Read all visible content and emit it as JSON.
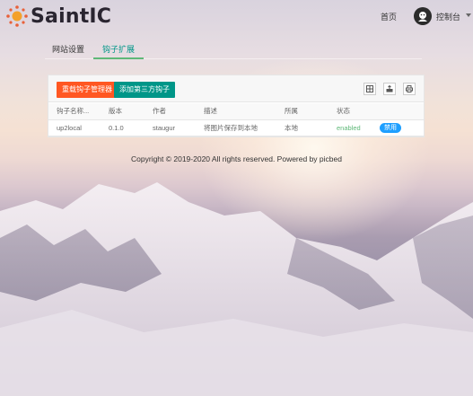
{
  "brand": {
    "name": "SaintIC",
    "logo_icon": "sun-logo-icon"
  },
  "header": {
    "home_label": "首页",
    "console_label": "控制台",
    "avatar_icon": "user-avatar-icon",
    "caret_icon": "chevron-down-icon"
  },
  "tabs": [
    {
      "label": "网站设置"
    },
    {
      "label": "钩子扩展",
      "active": true
    }
  ],
  "toolbar": {
    "reload_label": "重载钩子管理器",
    "add_label": "添加第三方钩子",
    "icons": [
      "columns-icon",
      "export-icon",
      "print-icon"
    ]
  },
  "table": {
    "columns": [
      "钩子名称...",
      "版本",
      "作者",
      "描述",
      "所属",
      "状态",
      ""
    ],
    "rows": [
      {
        "name": "up2local",
        "version": "0.1.0",
        "author": "staugur",
        "description": "将图片保存到本地",
        "belongs": "本地",
        "status": "enabled",
        "action": "禁用"
      }
    ]
  },
  "footer": {
    "copyright": "Copyright © 2019-2020 All rights reserved. Powered by picbed"
  },
  "colors": {
    "accent_green": "#009688",
    "danger": "#FF5722",
    "tab_underline": "#5FB878",
    "status_enabled": "#5FB878",
    "badge_blue": "#1E9FFF"
  }
}
